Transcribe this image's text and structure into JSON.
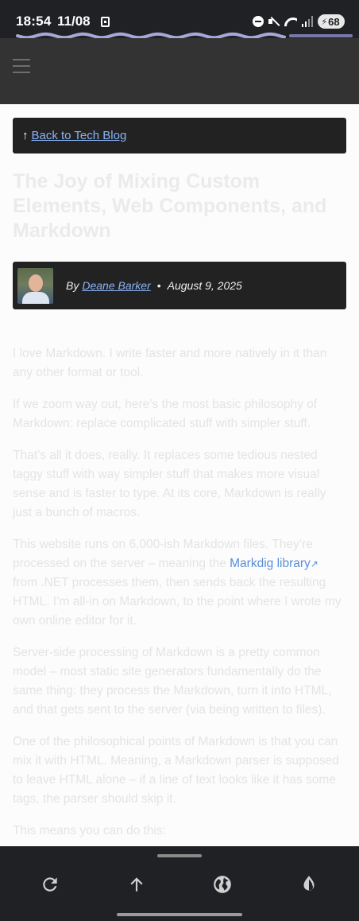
{
  "status": {
    "time": "18:54",
    "date": "11/08",
    "battery": "68",
    "icons": [
      "app-icon",
      "dnd-icon",
      "mute-icon",
      "wifi-icon",
      "signal-icon",
      "battery-charging-icon"
    ]
  },
  "page_load_progress": 0.8,
  "header": {
    "menu_icon": "hamburger-menu-icon"
  },
  "back": {
    "arrow": "↑",
    "label": "Back to Tech Blog"
  },
  "post": {
    "title": "The Joy of Mixing Custom Elements, Web Components, and Markdown",
    "byline_prefix": "By",
    "author": "Deane Barker",
    "separator": "•",
    "date": "August 9, 2025"
  },
  "article": {
    "p1": "I love Markdown. I write faster and more natively in it than any other format or tool.",
    "p2": "If we zoom way out, here’s the most basic philosophy of Markdown: replace complicated stuff with simpler stuff.",
    "p3": "That’s all it does, really. It replaces some tedious nested taggy stuff with way simpler stuff that makes more visual sense and is faster to type. At its core, Markdown is really just a bunch of macros.",
    "p4_before": "This website runs on 6,000-ish Markdown files. They’re processed on the server – meaning the ",
    "p4_link": "Markdig library",
    "p4_link_icon": "↗",
    "p4_after": " from .NET processes them, then sends back the resulting HTML. I’m all-in on Markdown, to the point where I wrote my own online editor for it.",
    "p5": "Server-side processing of Markdown is a pretty common model – most static site generators fundamentally do the same thing: they process the Markdown, turn it into HTML, and that gets sent to the server (via being written to files).",
    "p6": "One of the philosophical points of Markdown is that you can mix it with HTML. Meaning, a Markdown parser is supposed to leave HTML alone – if a line of text looks like it has some tags, the parser should skip it.",
    "p7": "This means you can do this:"
  },
  "toolbar": {
    "buttons": [
      "refresh-icon",
      "scroll-top-icon",
      "globe-icon",
      "contrast-icon"
    ]
  },
  "colors": {
    "page_bg": "#fcfcfc",
    "header_bg": "#333333",
    "panel_bg": "#222222",
    "link": "#8ab4f8",
    "system_bar": "#202124"
  }
}
